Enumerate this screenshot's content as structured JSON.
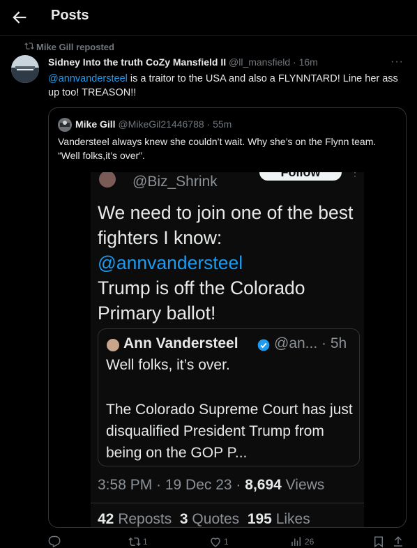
{
  "header": {
    "title": "Posts",
    "back_icon": "arrow-left-icon"
  },
  "repost": {
    "label": "Mike Gill reposted",
    "icon": "repost-icon"
  },
  "post": {
    "author_name": "Sidney Into the truth CoZy Mansfield II",
    "author_handle": "@ll_mansfield",
    "time": "16m",
    "more": "···",
    "mention": "@annvandersteel",
    "text": " is a traitor to the USA and also a FLYNNTARD! Line her ass up too! TREASON!!"
  },
  "quoted": {
    "author_name": "Mike Gill",
    "author_handle": "@MikeGil21446788",
    "time": "55m",
    "text": "Vandersteel always knew she couldn’t wait.  Why she’s on the Flynn team.   “Well folks,it’s over”.",
    "media": {
      "handle": "@Biz_Shrink",
      "follow_label": "Follow",
      "body_line1": "We need to join one of the best fighters I know:",
      "mention": "@annvandersteel",
      "body_line2": "Trump is off the Colorado Primary ballot!",
      "inner_quote": {
        "name": "Ann Vandersteel",
        "handle": "@an...",
        "time": "5h",
        "line1": "Well folks, it’s over.",
        "para": "The Colorado Supreme Court has just disqualified President Trump from being on the GOP P..."
      },
      "timestamp": "3:58 PM · 19 Dec 23 · ",
      "views_count": "8,694",
      "views_label": " Views",
      "reposts_count": "42",
      "reposts_label": " Reposts",
      "quotes_count": "3",
      "quotes_label": " Quotes",
      "likes_count": "195",
      "likes_label": " Likes"
    }
  },
  "actions": {
    "reply_count": "",
    "repost_count": "1",
    "like_count": "1",
    "views_count": "26"
  },
  "colors": {
    "accent": "#1d9bf0",
    "muted": "#71767b",
    "text": "#e7e9ea",
    "background": "#000000"
  }
}
